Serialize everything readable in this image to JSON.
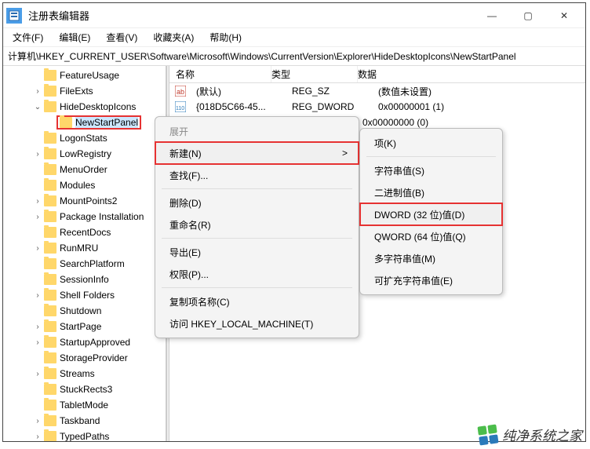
{
  "window": {
    "title": "注册表编辑器",
    "min": "—",
    "max": "▢",
    "close": "✕"
  },
  "menubar": [
    "文件(F)",
    "编辑(E)",
    "查看(V)",
    "收藏夹(A)",
    "帮助(H)"
  ],
  "address": "计算机\\HKEY_CURRENT_USER\\Software\\Microsoft\\Windows\\CurrentVersion\\Explorer\\HideDesktopIcons\\NewStartPanel",
  "tree": [
    {
      "indent": 2,
      "chevron": "",
      "label": "FeatureUsage"
    },
    {
      "indent": 2,
      "chevron": ">",
      "label": "FileExts"
    },
    {
      "indent": 2,
      "chevron": "v",
      "label": "HideDesktopIcons"
    },
    {
      "indent": 3,
      "chevron": "",
      "label": "NewStartPanel",
      "selected": true
    },
    {
      "indent": 2,
      "chevron": "",
      "label": "LogonStats"
    },
    {
      "indent": 2,
      "chevron": ">",
      "label": "LowRegistry"
    },
    {
      "indent": 2,
      "chevron": "",
      "label": "MenuOrder"
    },
    {
      "indent": 2,
      "chevron": "",
      "label": "Modules"
    },
    {
      "indent": 2,
      "chevron": ">",
      "label": "MountPoints2"
    },
    {
      "indent": 2,
      "chevron": ">",
      "label": "Package Installation"
    },
    {
      "indent": 2,
      "chevron": "",
      "label": "RecentDocs"
    },
    {
      "indent": 2,
      "chevron": ">",
      "label": "RunMRU"
    },
    {
      "indent": 2,
      "chevron": "",
      "label": "SearchPlatform"
    },
    {
      "indent": 2,
      "chevron": "",
      "label": "SessionInfo"
    },
    {
      "indent": 2,
      "chevron": ">",
      "label": "Shell Folders"
    },
    {
      "indent": 2,
      "chevron": "",
      "label": "Shutdown"
    },
    {
      "indent": 2,
      "chevron": ">",
      "label": "StartPage"
    },
    {
      "indent": 2,
      "chevron": ">",
      "label": "StartupApproved"
    },
    {
      "indent": 2,
      "chevron": "",
      "label": "StorageProvider"
    },
    {
      "indent": 2,
      "chevron": ">",
      "label": "Streams"
    },
    {
      "indent": 2,
      "chevron": "",
      "label": "StuckRects3"
    },
    {
      "indent": 2,
      "chevron": "",
      "label": "TabletMode"
    },
    {
      "indent": 2,
      "chevron": ">",
      "label": "Taskband"
    },
    {
      "indent": 2,
      "chevron": ">",
      "label": "TypedPaths"
    }
  ],
  "list": {
    "headers": {
      "name": "名称",
      "type": "类型",
      "data": "数据"
    },
    "rows": [
      {
        "icon": "ab",
        "name": "(默认)",
        "type": "REG_SZ",
        "data": "(数值未设置)"
      },
      {
        "icon": "110",
        "name": "{018D5C66-45...",
        "type": "REG_DWORD",
        "data": "0x00000001 (1)"
      },
      {
        "icon": "",
        "name": "",
        "type": "",
        "data": "0x00000000 (0)"
      }
    ]
  },
  "context_menu_1": [
    {
      "label": "展开",
      "disabled": true
    },
    {
      "label": "新建(N)",
      "arrow": true,
      "highlighted": true
    },
    {
      "label": "查找(F)..."
    },
    {
      "sep": true
    },
    {
      "label": "删除(D)"
    },
    {
      "label": "重命名(R)"
    },
    {
      "sep": true
    },
    {
      "label": "导出(E)"
    },
    {
      "label": "权限(P)..."
    },
    {
      "sep": true
    },
    {
      "label": "复制项名称(C)"
    },
    {
      "label": "访问 HKEY_LOCAL_MACHINE(T)"
    }
  ],
  "context_menu_2": [
    {
      "label": "项(K)"
    },
    {
      "sep": true
    },
    {
      "label": "字符串值(S)"
    },
    {
      "label": "二进制值(B)"
    },
    {
      "label": "DWORD (32 位)值(D)",
      "highlighted": true
    },
    {
      "label": "QWORD (64 位)值(Q)"
    },
    {
      "label": "多字符串值(M)"
    },
    {
      "label": "可扩充字符串值(E)"
    }
  ],
  "watermark": "纯净系统之家"
}
